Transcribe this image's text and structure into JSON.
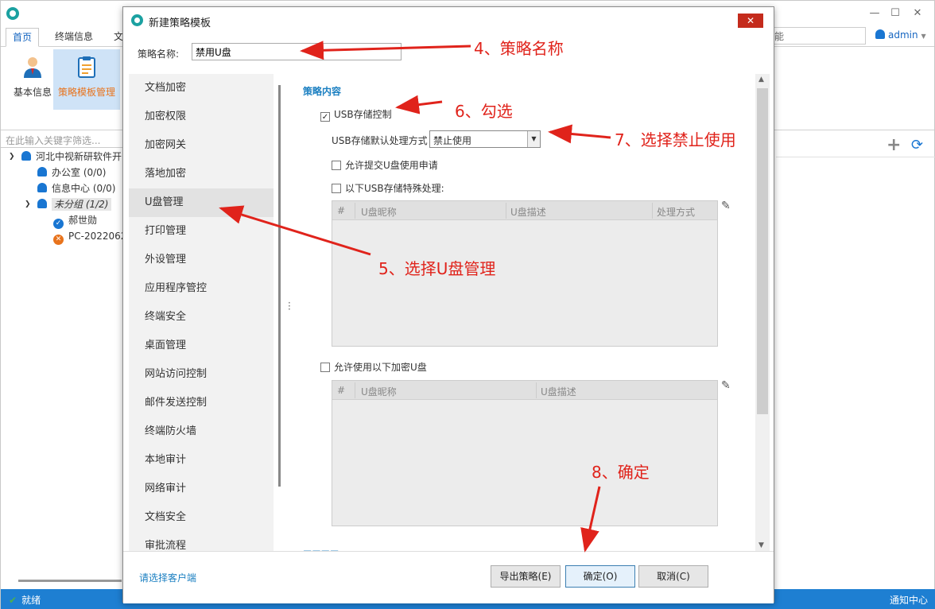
{
  "app": {
    "tabs": [
      {
        "label": "首页",
        "active": true
      },
      {
        "label": "终端信息",
        "active": false
      },
      {
        "label": "文",
        "active": false
      }
    ],
    "search_placeholder": "能",
    "user": "admin",
    "ribbon": [
      {
        "label": "基本信息",
        "icon": "person-icon",
        "active": false
      },
      {
        "label": "策略模板管理",
        "icon": "clipboard-icon",
        "active": true
      }
    ],
    "filter_placeholder": "在此输入关键字筛选...",
    "tree": [
      {
        "label": "河北中视新研软件开",
        "icon": "group-icon",
        "level": 0,
        "expanded": true
      },
      {
        "label": "办公室 (0/0)",
        "icon": "group-icon",
        "level": 1
      },
      {
        "label": "信息中心 (0/0)",
        "icon": "group-icon",
        "level": 1
      },
      {
        "label": "未分组 (1/2)",
        "icon": "group-icon",
        "level": 1,
        "expanded": true,
        "selected": true
      },
      {
        "label": "郝世勋",
        "icon": "online-icon",
        "level": 2
      },
      {
        "label": "PC-2022062",
        "icon": "offline-icon",
        "level": 2
      }
    ],
    "status": "就绪",
    "status_right": "通知中心"
  },
  "dialog": {
    "title": "新建策略模板",
    "name_label": "策略名称:",
    "name_value": "禁用U盘",
    "nav": [
      "文档加密",
      "加密权限",
      "加密网关",
      "落地加密",
      "U盘管理",
      "打印管理",
      "外设管理",
      "应用程序管控",
      "终端安全",
      "桌面管理",
      "网站访问控制",
      "邮件发送控制",
      "终端防火墙",
      "本地审计",
      "网络审计",
      "文档安全",
      "审批流程"
    ],
    "nav_active_index": 4,
    "content": {
      "section_title": "策略内容",
      "usb_control_label": "USB存储控制",
      "usb_control_checked": true,
      "default_action_label": "USB存储默认处理方式",
      "default_action_value": "禁止使用",
      "allow_request_label": "允许提交U盘使用申请",
      "allow_request_checked": false,
      "special_label": "以下USB存储特殊处理:",
      "special_checked": false,
      "grid1_columns": [
        "#",
        "U盘昵称",
        "U盘描述",
        "处理方式"
      ],
      "allow_encrypted_label": "允许使用以下加密U盘",
      "allow_encrypted_checked": false,
      "grid2_columns": [
        "#",
        "U盘昵称",
        "U盘描述"
      ]
    },
    "client_link": "请选择客户端",
    "buttons": {
      "export": "导出策略(E)",
      "ok": "确定(O)",
      "cancel": "取消(C)"
    }
  },
  "annotations": {
    "step4": "4、策略名称",
    "step5": "5、选择U盘管理",
    "step6": "6、勾选",
    "step7": "7、选择禁止使用",
    "step8": "8、确定"
  },
  "colors": {
    "accent": "#1a7fc1",
    "statusbar": "#1e7fd2",
    "annotation": "#e0231b",
    "close": "#c42b1c"
  }
}
